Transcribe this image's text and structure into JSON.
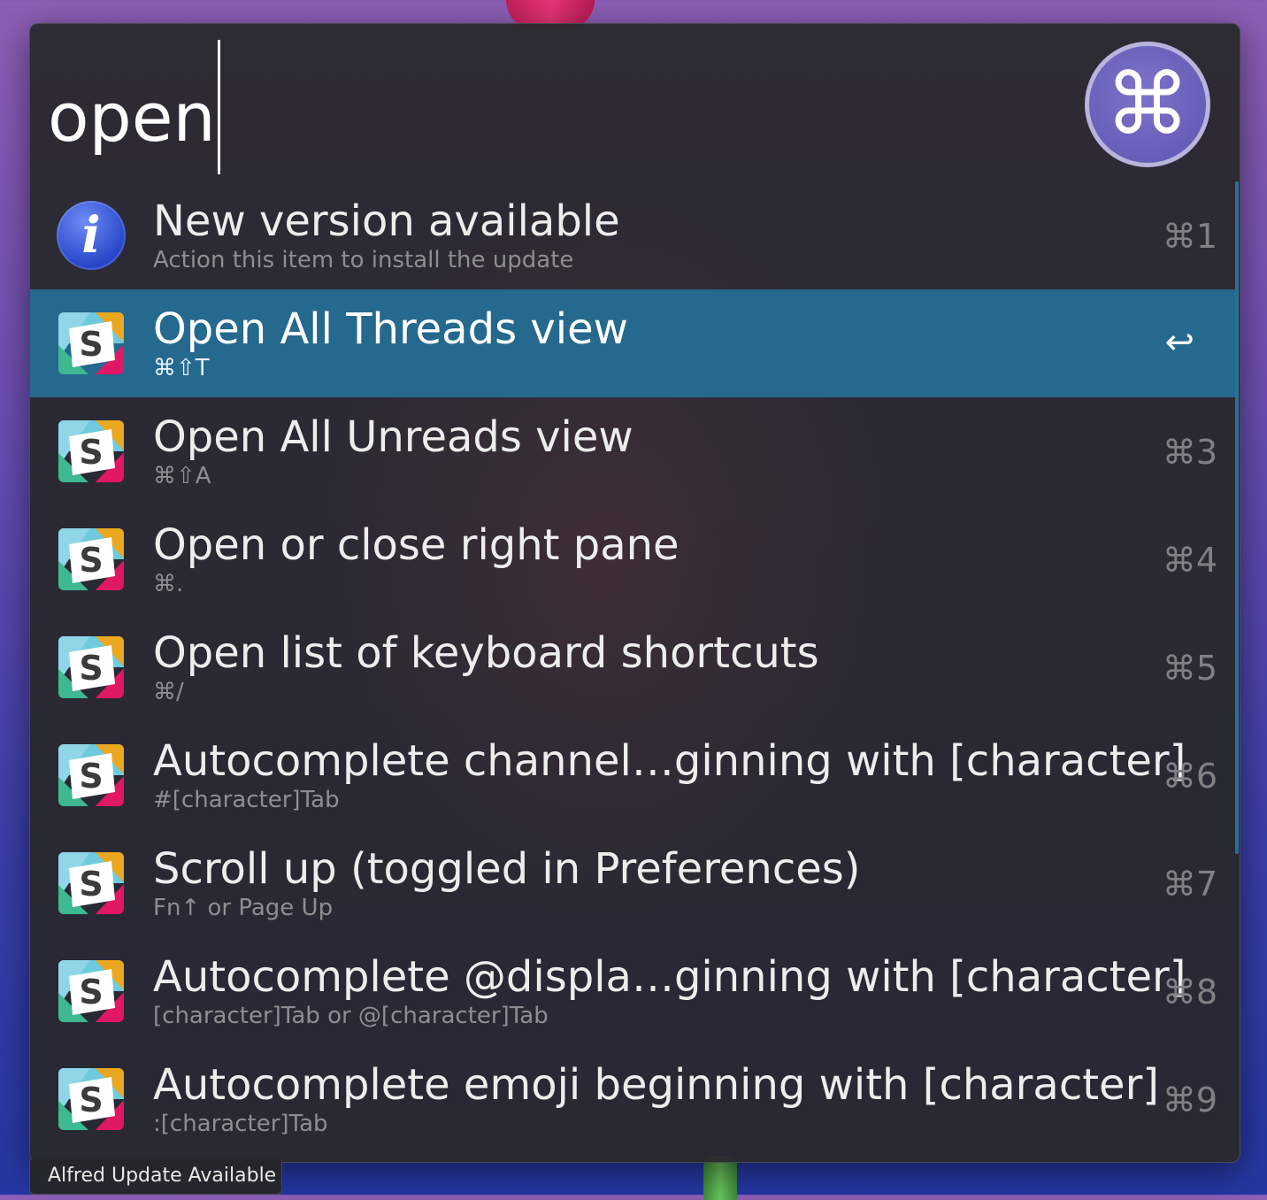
{
  "search": {
    "query": "open"
  },
  "hotkey_badge": {
    "symbol": "⌘",
    "icon": "command-key-icon",
    "color": "#6a62bd"
  },
  "results": [
    {
      "icon": "info-icon",
      "title": "New version available",
      "subtitle": "Action this item to install the update",
      "shortcut": "⌘1",
      "selected": false
    },
    {
      "icon": "slack-app-icon",
      "title": "Open All Threads view",
      "subtitle": "⌘⇧T",
      "shortcut": "↩",
      "selected": true
    },
    {
      "icon": "slack-app-icon",
      "title": "Open All Unreads view",
      "subtitle": "⌘⇧A",
      "shortcut": "⌘3",
      "selected": false
    },
    {
      "icon": "slack-app-icon",
      "title": "Open or close right pane",
      "subtitle": "⌘.",
      "shortcut": "⌘4",
      "selected": false
    },
    {
      "icon": "slack-app-icon",
      "title": "Open list of keyboard shortcuts",
      "subtitle": "⌘/",
      "shortcut": "⌘5",
      "selected": false
    },
    {
      "icon": "slack-app-icon",
      "title": "Autocomplete channel…ginning with [character]",
      "subtitle": "#[character]Tab",
      "shortcut": "⌘6",
      "selected": false
    },
    {
      "icon": "slack-app-icon",
      "title": "Scroll up (toggled in Preferences)",
      "subtitle": "Fn↑ or Page Up",
      "shortcut": "⌘7",
      "selected": false
    },
    {
      "icon": "slack-app-icon",
      "title": "Autocomplete @displa…ginning with [character]",
      "subtitle": "[character]Tab or @[character]Tab",
      "shortcut": "⌘8",
      "selected": false
    },
    {
      "icon": "slack-app-icon",
      "title": "Autocomplete emoji beginning with [character]",
      "subtitle": ":[character]Tab",
      "shortcut": "⌘9",
      "selected": false
    }
  ],
  "info_icon_glyph": "i",
  "update_notice": "Alfred Update Available",
  "colors": {
    "selection": "#25698e",
    "window_bg": "#28282d",
    "title_text": "#ededed",
    "subtitle_text": "#8e8e92",
    "shortcut_text": "#808085"
  }
}
